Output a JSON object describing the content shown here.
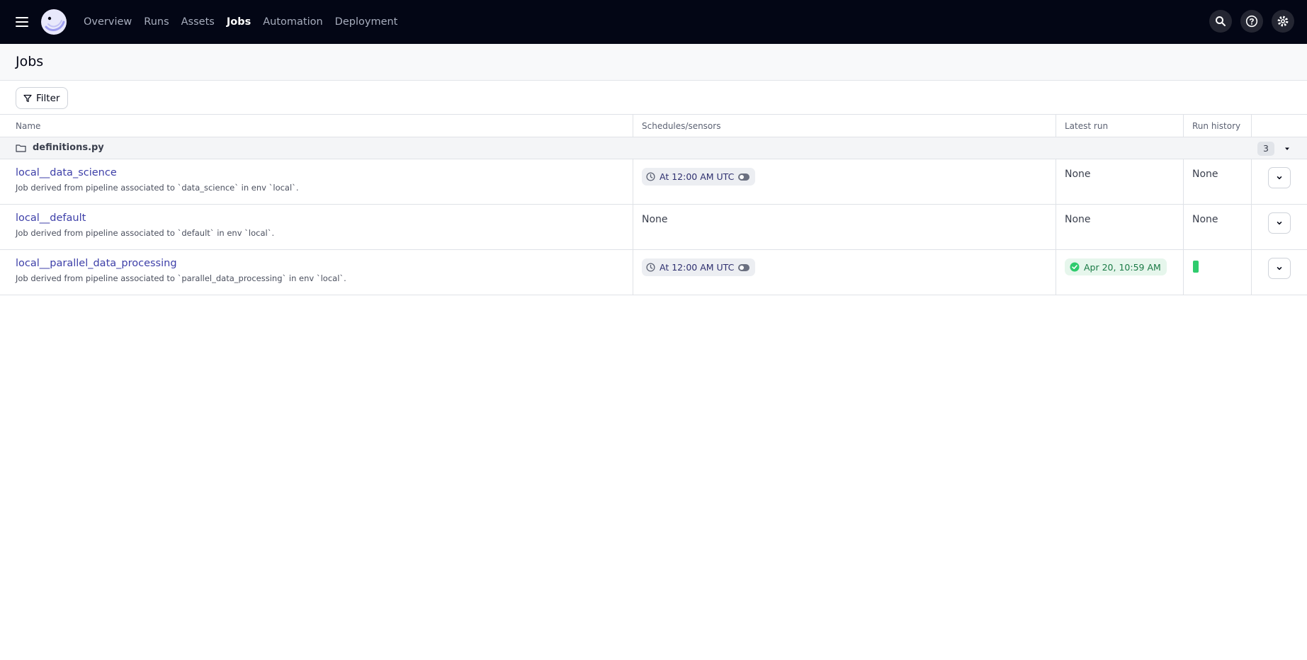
{
  "nav": {
    "items": [
      {
        "label": "Overview",
        "active": false
      },
      {
        "label": "Runs",
        "active": false
      },
      {
        "label": "Assets",
        "active": false
      },
      {
        "label": "Jobs",
        "active": true
      },
      {
        "label": "Automation",
        "active": false
      },
      {
        "label": "Deployment",
        "active": false
      }
    ],
    "icons": [
      "search-icon",
      "help-icon",
      "gear-icon"
    ]
  },
  "page": {
    "title": "Jobs"
  },
  "filter": {
    "label": "Filter"
  },
  "table": {
    "headers": {
      "name": "Name",
      "schedules": "Schedules/sensors",
      "latest_run": "Latest run",
      "run_history": "Run history"
    },
    "group": {
      "label": "definitions.py",
      "count": "3"
    },
    "rows": [
      {
        "name": "local__data_science",
        "description": "Job derived from pipeline associated to `data_science` in env `local`.",
        "schedule": "At 12:00 AM UTC",
        "latest_run": "None",
        "run_history": "None"
      },
      {
        "name": "local__default",
        "description": "Job derived from pipeline associated to `default` in env `local`.",
        "schedule": "None",
        "latest_run": "None",
        "run_history": "None"
      },
      {
        "name": "local__parallel_data_processing",
        "description": "Job derived from pipeline associated to `parallel_data_processing` in env `local`.",
        "schedule": "At 12:00 AM UTC",
        "latest_run": "Apr 20, 10:59 AM",
        "latest_run_status": "success",
        "run_history": "1 successful run"
      }
    ]
  },
  "colors": {
    "nav_bg": "#030615",
    "link": "#3d3fa8",
    "success": "#2fcb6d"
  }
}
